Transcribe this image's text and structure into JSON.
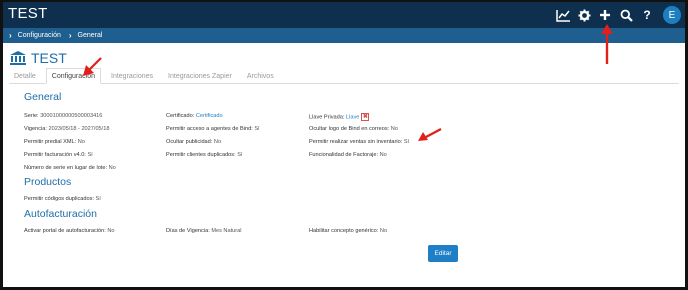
{
  "app": {
    "title": "TEST",
    "avatar_letter": "E"
  },
  "top_icons": [
    "chart-line-icon",
    "gear-icon",
    "plus-icon",
    "search-icon",
    "help-icon"
  ],
  "breadcrumb": [
    "Configuración",
    "General"
  ],
  "page": {
    "title": "TEST",
    "icon": "bank-icon"
  },
  "tabs": [
    {
      "label": "Detalle",
      "active": false
    },
    {
      "label": "Configuración",
      "active": true
    },
    {
      "label": "Integraciones",
      "active": false
    },
    {
      "label": "Integraciones Zapier",
      "active": false
    },
    {
      "label": "Archivos",
      "active": false
    }
  ],
  "sections": {
    "general": {
      "title": "General",
      "serie": {
        "label": "Serie:",
        "value": "30001000000500003416"
      },
      "vigencia": {
        "label": "Vigencia:",
        "value": "2023/05/18 - 2027/05/18"
      },
      "predial": {
        "label": "Permitir predial XML:",
        "value": "No"
      },
      "facturacion": {
        "label": "Permitir facturación v4.0:",
        "value": "Sí"
      },
      "numero_serie": {
        "label": "Número de serie en lugar de lote:",
        "value": "No"
      },
      "certificado": {
        "label": "Certificado:",
        "value": "Certificado"
      },
      "agentes": {
        "label": "Permitir acceso a agentes de Bind:",
        "value": "Sí"
      },
      "publicidad": {
        "label": "Ocultar publicidad:",
        "value": "No"
      },
      "clientes_dup": {
        "label": "Permitir clientes duplicados:",
        "value": "Sí"
      },
      "llave": {
        "label": "Llave Privada:",
        "value": "Llave",
        "x": "✖"
      },
      "logo": {
        "label": "Ocultar logo de Bind en correos:",
        "value": "No"
      },
      "ventas": {
        "label": "Permitir realizar ventas sin inventario:",
        "value": "Sí"
      },
      "factoraje": {
        "label": "Funcionalidad de Factoraje:",
        "value": "No"
      }
    },
    "productos": {
      "title": "Productos",
      "codigos": {
        "label": "Permitir códigos duplicados:",
        "value": "Sí"
      }
    },
    "autofacturacion": {
      "title": "Autofacturación",
      "portal": {
        "label": "Activar portal de autofacturación:",
        "value": "No"
      },
      "dias": {
        "label": "Días de Vigencia:",
        "value": "Mes Natural"
      },
      "concepto": {
        "label": "Habilitar concepto genérico:",
        "value": "No"
      }
    }
  },
  "edit_button": {
    "label": "Editar"
  },
  "colors": {
    "topbar": "#0f2f4f",
    "breadcrumb": "#1f5f8f",
    "accent": "#1e6ea7",
    "button": "#1e7fc6",
    "annotation_arrow": "#e0201b"
  }
}
